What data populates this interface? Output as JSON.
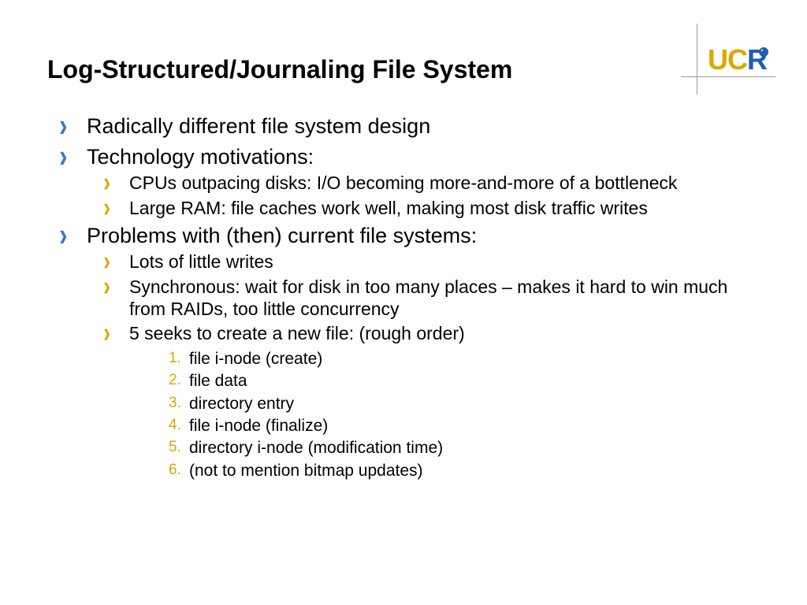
{
  "logo": {
    "text": "UCR"
  },
  "title": "Log-Structured/Journaling File System",
  "bullets": {
    "a": "Radically different file system design",
    "b": "Technology motivations:",
    "b1": "CPUs outpacing disks: I/O becoming more-and-more of a bottleneck",
    "b2": "Large RAM: file caches work well, making most disk traffic writes",
    "c": "Problems with (then) current file systems:",
    "c1": "Lots of little writes",
    "c2": "Synchronous: wait for disk in too many places – makes it hard to win much from RAIDs, too little concurrency",
    "c3": "5 seeks to create a new file: (rough order)",
    "c3_1": "file i-node (create)",
    "c3_2": "file data",
    "c3_3": "directory entry",
    "c3_4": "file i-node (finalize)",
    "c3_5": "directory i-node (modification time)",
    "c3_6": "(not to mention bitmap updates)"
  }
}
